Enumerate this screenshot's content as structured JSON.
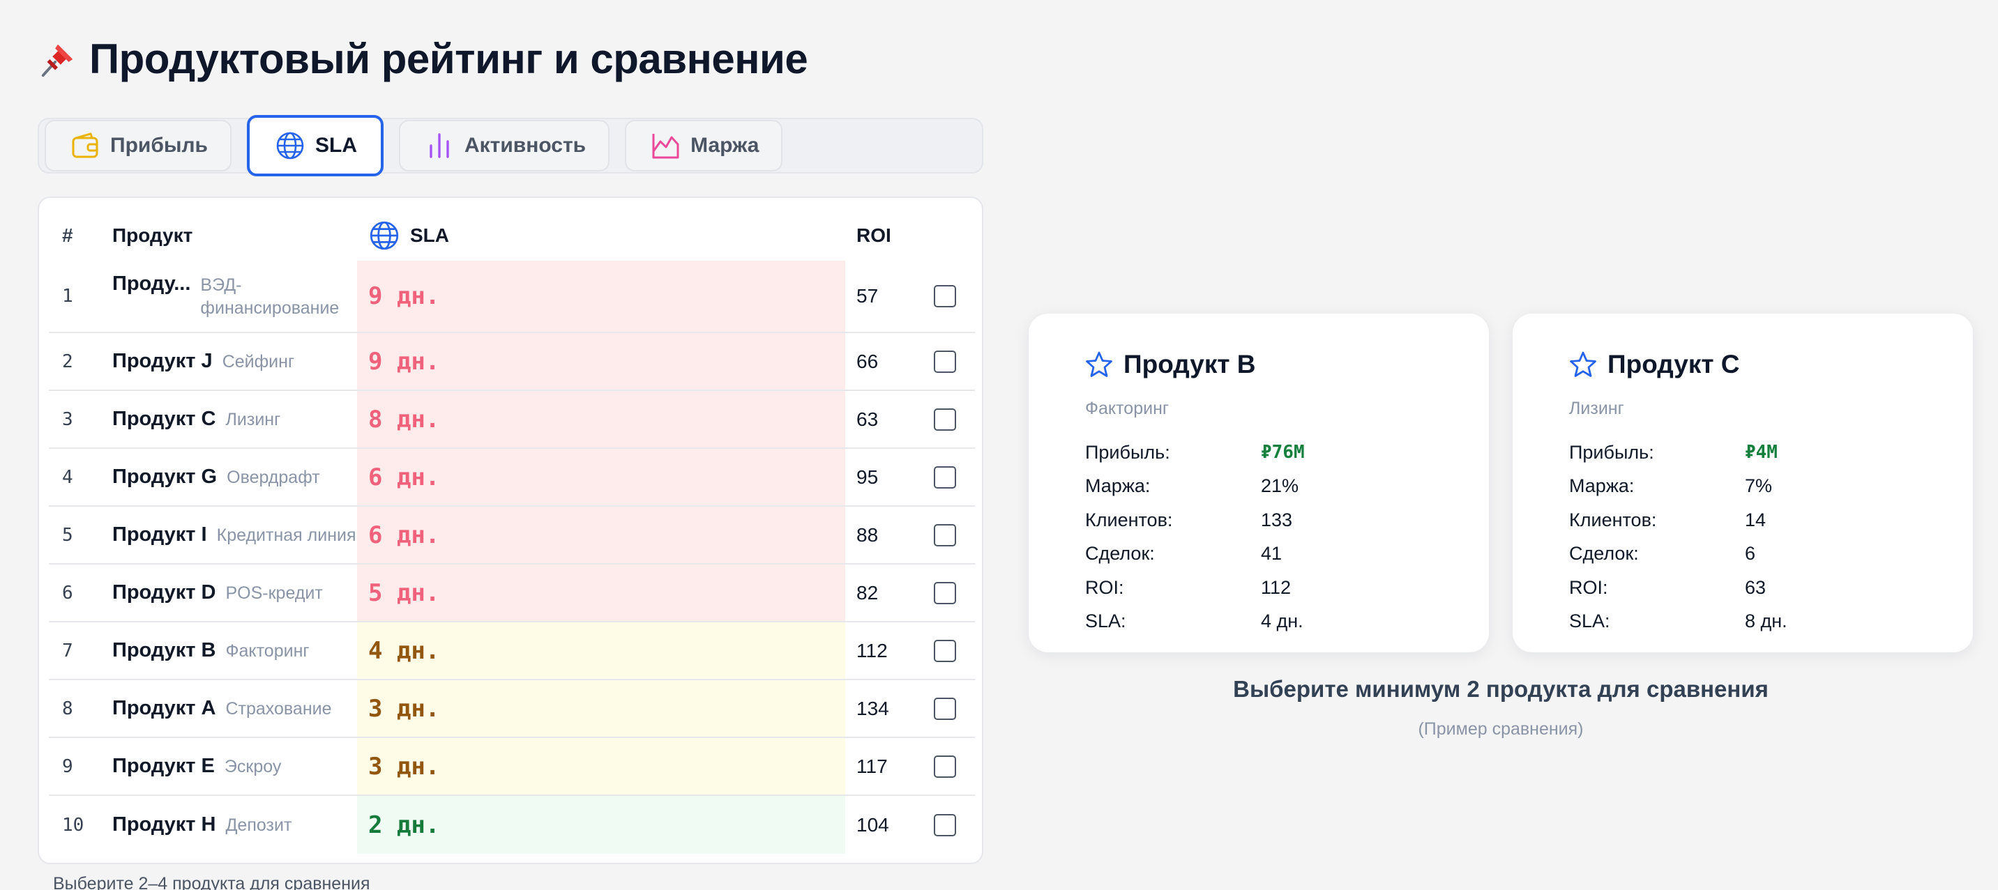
{
  "header": {
    "title": "Продуктовый рейтинг и сравнение",
    "icon": "pushpin-icon"
  },
  "tabs": [
    {
      "label": "Прибыль",
      "icon": "wallet-icon",
      "color": "#eab308",
      "active": false
    },
    {
      "label": "SLA",
      "icon": "globe-icon",
      "color": "#2563eb",
      "active": true
    },
    {
      "label": "Активность",
      "icon": "bar-chart-icon",
      "color": "#a855f7",
      "active": false
    },
    {
      "label": "Маржа",
      "icon": "area-chart-icon",
      "color": "#ec4899",
      "active": false
    }
  ],
  "table": {
    "headers": {
      "num": "#",
      "product": "Продукт",
      "sla": "SLA",
      "roi": "ROI"
    },
    "rows": [
      {
        "num": "1",
        "name": "Проду...",
        "category": "ВЭД-финансирование",
        "sla": "9 дн.",
        "sla_level": "red",
        "roi": "57",
        "checked": false
      },
      {
        "num": "2",
        "name": "Продукт J",
        "category": "Сейфинг",
        "sla": "9 дн.",
        "sla_level": "red",
        "roi": "66",
        "checked": false
      },
      {
        "num": "3",
        "name": "Продукт C",
        "category": "Лизинг",
        "sla": "8 дн.",
        "sla_level": "red",
        "roi": "63",
        "checked": false
      },
      {
        "num": "4",
        "name": "Продукт G",
        "category": "Овердрафт",
        "sla": "6 дн.",
        "sla_level": "red",
        "roi": "95",
        "checked": false
      },
      {
        "num": "5",
        "name": "Продукт I",
        "category": "Кредитная линия",
        "sla": "6 дн.",
        "sla_level": "red",
        "roi": "88",
        "checked": false
      },
      {
        "num": "6",
        "name": "Продукт D",
        "category": "POS-кредит",
        "sla": "5 дн.",
        "sla_level": "red",
        "roi": "82",
        "checked": false
      },
      {
        "num": "7",
        "name": "Продукт B",
        "category": "Факторинг",
        "sla": "4 дн.",
        "sla_level": "yellow",
        "roi": "112",
        "checked": false
      },
      {
        "num": "8",
        "name": "Продукт A",
        "category": "Страхование",
        "sla": "3 дн.",
        "sla_level": "yellow",
        "roi": "134",
        "checked": false
      },
      {
        "num": "9",
        "name": "Продукт E",
        "category": "Эскроу",
        "sla": "3 дн.",
        "sla_level": "yellow",
        "roi": "117",
        "checked": false
      },
      {
        "num": "10",
        "name": "Продукт H",
        "category": "Депозит",
        "sla": "2 дн.",
        "sla_level": "green",
        "roi": "104",
        "checked": false
      }
    ],
    "hint": "Выберите 2–4 продукта для сравнения"
  },
  "compare": {
    "cards": [
      {
        "name": "Продукт B",
        "category": "Факторинг",
        "stats": [
          {
            "label": "Прибыль:",
            "value": "₽76M",
            "money": true
          },
          {
            "label": "Маржа:",
            "value": "21%"
          },
          {
            "label": "Клиентов:",
            "value": "133"
          },
          {
            "label": "Сделок:",
            "value": "41"
          },
          {
            "label": "ROI:",
            "value": "112"
          },
          {
            "label": "SLA:",
            "value": "4 дн."
          }
        ]
      },
      {
        "name": "Продукт C",
        "category": "Лизинг",
        "stats": [
          {
            "label": "Прибыль:",
            "value": "₽4M",
            "money": true
          },
          {
            "label": "Маржа:",
            "value": "7%"
          },
          {
            "label": "Клиентов:",
            "value": "14"
          },
          {
            "label": "Сделок:",
            "value": "6"
          },
          {
            "label": "ROI:",
            "value": "63"
          },
          {
            "label": "SLA:",
            "value": "8 дн."
          }
        ]
      }
    ],
    "message": "Выберите минимум 2 продукта для сравнения",
    "sub": "(Пример сравнения)"
  }
}
